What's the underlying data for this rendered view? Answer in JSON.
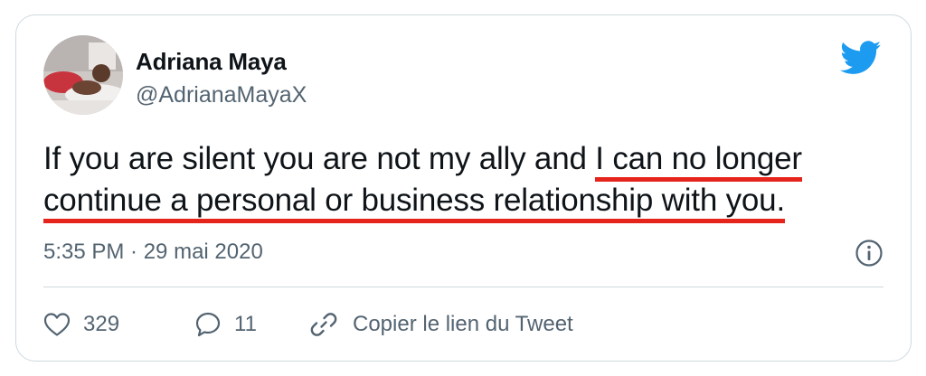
{
  "author": {
    "name": "Adriana Maya",
    "handle": "@AdrianaMayaX"
  },
  "tweet": {
    "text_before": "If you are silent you are not my ally and ",
    "text_highlighted": "I can no longer continue a personal or business relationship with you.",
    "timestamp": "5:35 PM · 29 mai 2020"
  },
  "actions": {
    "likes": "329",
    "replies": "11",
    "copy_link_label": "Copier le lien du Tweet"
  },
  "icons": {
    "brand": "twitter-bird-icon",
    "info": "info-icon",
    "like": "heart-icon",
    "reply": "speech-bubble-icon",
    "link": "link-icon"
  },
  "colors": {
    "twitter_blue": "#1d9bf0",
    "highlight_underline": "#e5251c",
    "secondary_text": "#536471",
    "border": "#cfd9de"
  }
}
